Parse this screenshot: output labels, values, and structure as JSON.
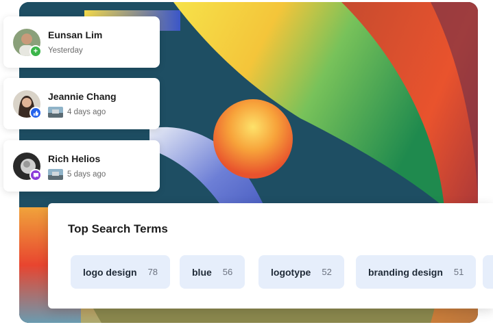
{
  "notifications": [
    {
      "name": "Eunsan Lim",
      "time": "Yesterday",
      "badge_icon": "plus-icon",
      "badge_color": "#3bb54a",
      "badge_glyph": "+"
    },
    {
      "name": "Jeannie Chang",
      "time": "4 days ago",
      "badge_icon": "thumbs-up-icon",
      "badge_color": "#2563eb",
      "badge_glyph": "↑"
    },
    {
      "name": "Rich Helios",
      "time": "5 days ago",
      "badge_icon": "comment-icon",
      "badge_color": "#8b3bd9",
      "badge_glyph": "▼"
    }
  ],
  "search_panel": {
    "title": "Top Search Terms",
    "terms": [
      {
        "term": "logo design",
        "count": "78"
      },
      {
        "term": "blue",
        "count": "56"
      },
      {
        "term": "logotype",
        "count": "52"
      },
      {
        "term": "branding design",
        "count": "51"
      }
    ]
  },
  "colors": {
    "artwork_base": "#1e4e63",
    "chip_bg": "#e6eefb"
  }
}
